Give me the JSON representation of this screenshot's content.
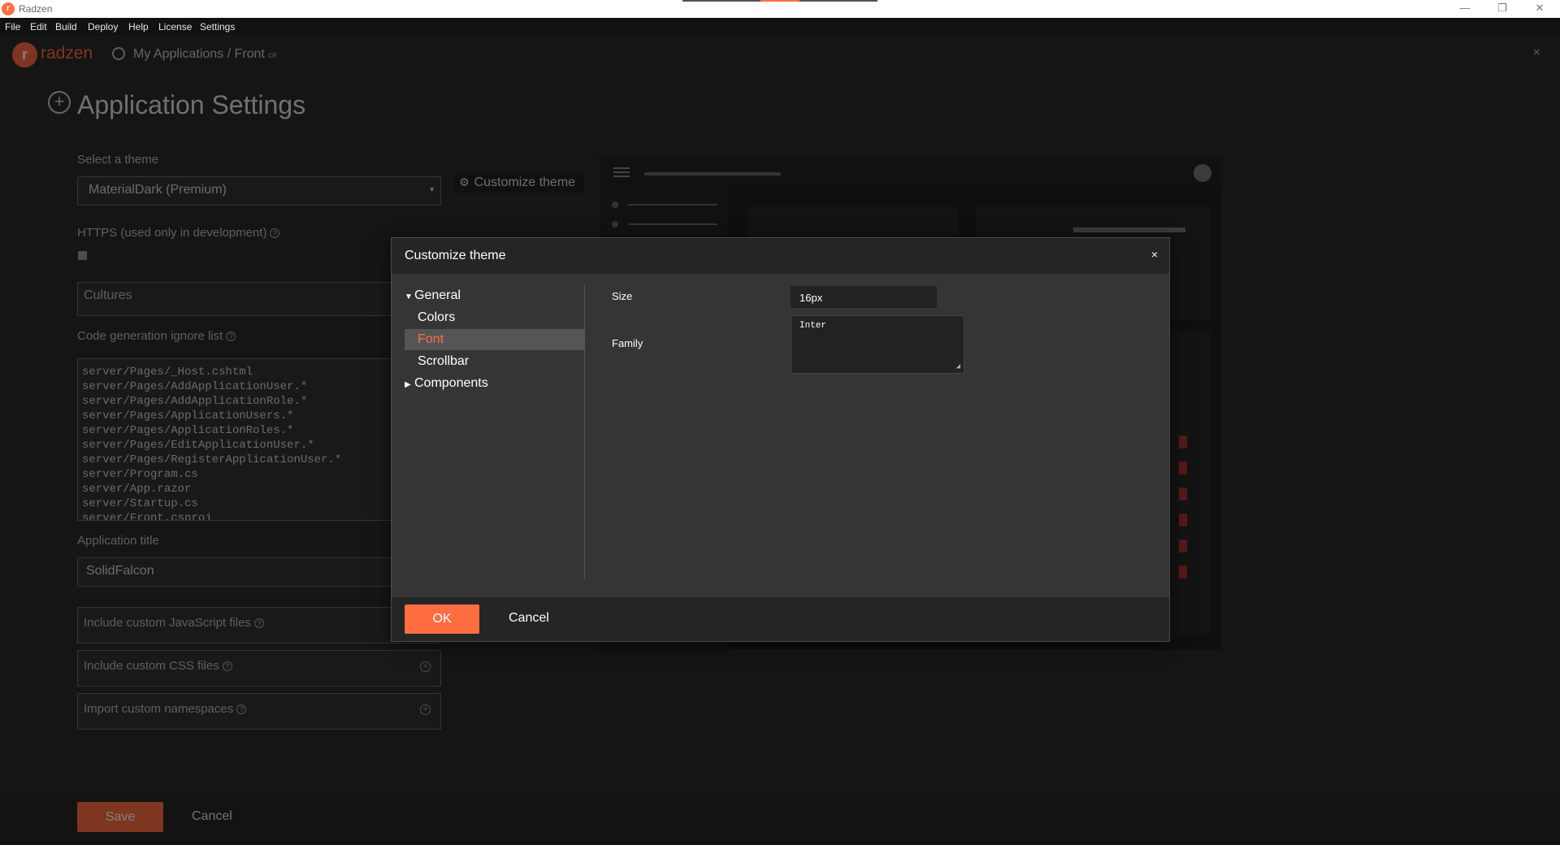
{
  "window": {
    "title": "Radzen",
    "minimize": "—",
    "restore": "❐",
    "close": "✕"
  },
  "menu": [
    "File",
    "Edit",
    "Build",
    "Deploy",
    "Help",
    "License",
    "Settings"
  ],
  "header": {
    "logo_text": "radzen",
    "breadcrumb": "My Applications / Front",
    "breadcrumb_sub": "c#",
    "close": "×"
  },
  "page": {
    "title": "Application Settings",
    "theme_label": "Select a theme",
    "theme_value": "MaterialDark (Premium)",
    "customize_button": "Customize theme",
    "https_label": "HTTPS (used only in development)",
    "cultures_label": "Cultures",
    "ignore_label": "Code generation ignore list",
    "ignore_list": [
      "server/Pages/_Host.cshtml",
      "server/Pages/AddApplicationUser.*",
      "server/Pages/AddApplicationRole.*",
      "server/Pages/ApplicationUsers.*",
      "server/Pages/ApplicationRoles.*",
      "server/Pages/EditApplicationUser.*",
      "server/Pages/RegisterApplicationUser.*",
      "server/Program.cs",
      "server/App.razor",
      "server/Startup.cs",
      "server/Front.csproj"
    ],
    "app_title_label": "Application title",
    "app_title_value": "SolidFalcon",
    "js_files_label": "Include custom JavaScript files",
    "css_files_label": "Include custom CSS files",
    "namespaces_label": "Import custom namespaces",
    "save": "Save",
    "cancel": "Cancel"
  },
  "dialog": {
    "title": "Customize theme",
    "close": "×",
    "tree": {
      "general": "General",
      "colors": "Colors",
      "font": "Font",
      "scrollbar": "Scrollbar",
      "components": "Components"
    },
    "size_label": "Size",
    "size_value": "16px",
    "family_label": "Family",
    "family_value": "Inter",
    "ok": "OK",
    "cancel": "Cancel"
  },
  "colors": {
    "accent": "#ff6d41",
    "dialog_bg": "#353535",
    "header_bg": "#252525"
  }
}
